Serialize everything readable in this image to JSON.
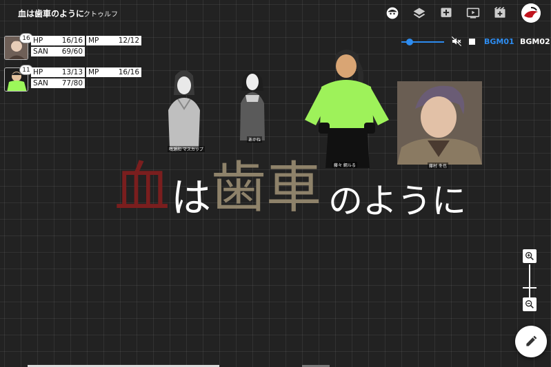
{
  "room": {
    "title": "血は歯車のように",
    "system": "クトゥルフ"
  },
  "toolbar": {
    "icons": [
      "character-face-icon",
      "layers-icon",
      "add-note-icon",
      "video-icon",
      "scene-icon",
      "account-avatar-icon"
    ]
  },
  "characters": [
    {
      "initiative": "16",
      "hp_label": "HP",
      "hp": "16/16",
      "mp_label": "MP",
      "mp": "12/12",
      "san_label": "SAN",
      "san": "69/60"
    },
    {
      "initiative": "11",
      "hp_label": "HP",
      "hp": "13/13",
      "mp_label": "MP",
      "mp": "16/16",
      "san_label": "SAN",
      "san": "77/80"
    }
  ],
  "bgm": {
    "volume": 0.2,
    "track1": "BGM01",
    "track2": "BGM02",
    "active_color": "#2d8cf0"
  },
  "logo": {
    "part1": "血",
    "part2": "は",
    "part3": "歯車",
    "part4": "のように"
  },
  "figures": [
    {
      "label": "鳴瀬和 マスカップ"
    },
    {
      "label": "あかね"
    },
    {
      "label": "藤々 綱ルる"
    },
    {
      "label": "藤村 冬也"
    }
  ],
  "colors": {
    "background": "#222222",
    "accent": "#2d8cf0",
    "blood": "#7a1e1e",
    "gear": "#8e826a"
  }
}
